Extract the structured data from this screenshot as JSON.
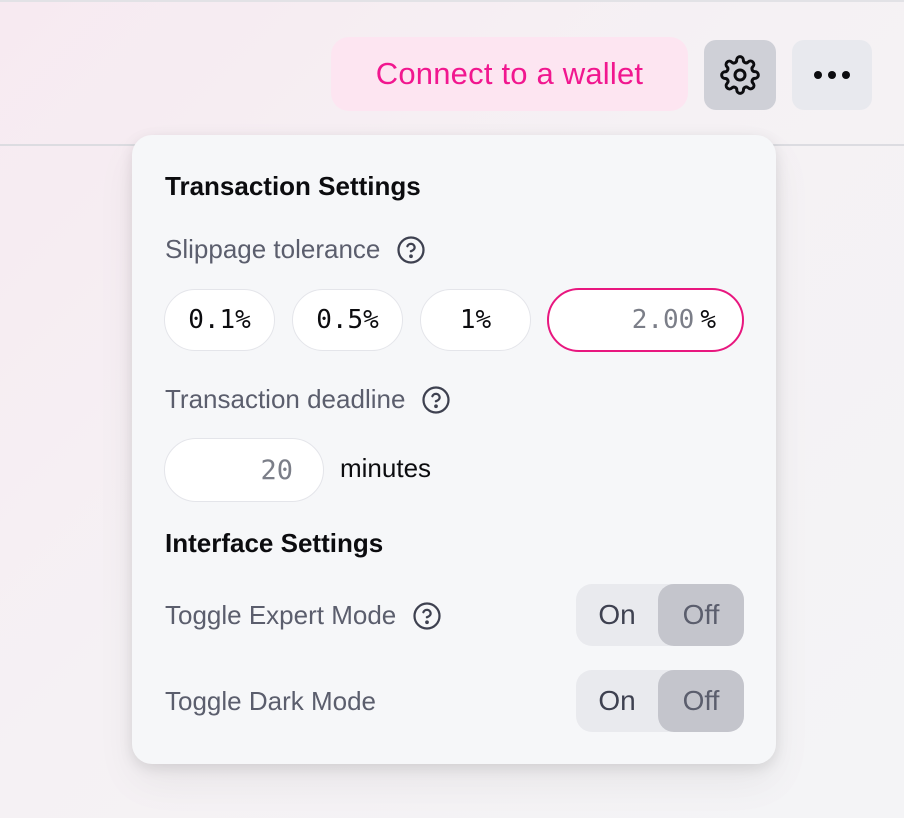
{
  "header": {
    "connect_label": "Connect to a wallet",
    "settings_icon": "gear-icon",
    "more_icon": "more-dots-icon"
  },
  "settings": {
    "transaction_title": "Transaction Settings",
    "slippage_label": "Slippage tolerance",
    "slippage_options": [
      "0.1%",
      "0.5%",
      "1%"
    ],
    "slippage_custom_value": "2.00",
    "slippage_custom_unit": "%",
    "deadline_label": "Transaction deadline",
    "deadline_value": "20",
    "deadline_unit": "minutes",
    "interface_title": "Interface Settings",
    "expert_mode_label": "Toggle Expert Mode",
    "dark_mode_label": "Toggle Dark Mode",
    "toggle_on_label": "On",
    "toggle_off_label": "Off",
    "expert_mode_state": "Off",
    "dark_mode_state": "Off"
  },
  "colors": {
    "accent_pink": "#f1178f",
    "connect_bg": "#fde5f1"
  }
}
